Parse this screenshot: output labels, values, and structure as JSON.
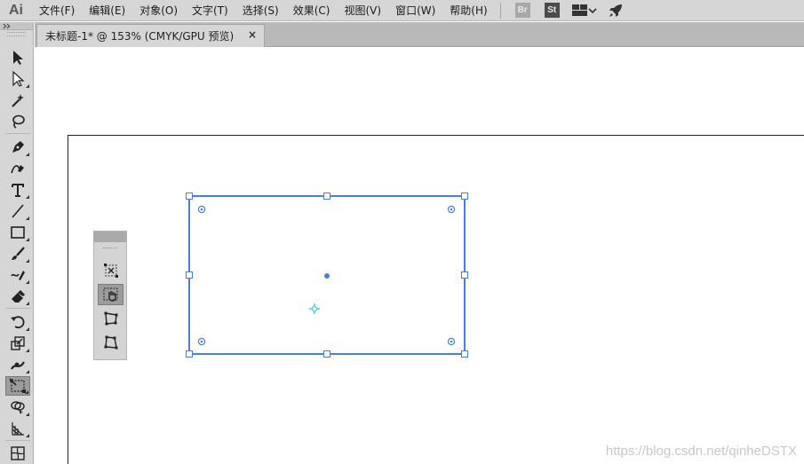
{
  "app": {
    "logo": "Ai",
    "menus": [
      "文件(F)",
      "编辑(E)",
      "对象(O)",
      "文字(T)",
      "选择(S)",
      "效果(C)",
      "视图(V)",
      "窗口(W)",
      "帮助(H)"
    ],
    "badges": {
      "bridge": "Br",
      "stock": "St"
    },
    "workspace_icon": "workspace-grid-icon",
    "launch_icon": "rocket-icon"
  },
  "document": {
    "tab_title": "未标题-1* @ 153% (CMYK/GPU 预览)",
    "close_glyph": "×"
  },
  "toolbar": {
    "tools": [
      "selection-tool",
      "direct-selection-tool",
      "magic-wand-tool",
      "lasso-tool",
      "pen-tool",
      "curvature-tool",
      "type-tool",
      "line-tool",
      "rectangle-tool",
      "paintbrush-tool",
      "shaper-tool",
      "eraser-tool",
      "rotate-tool",
      "scale-tool",
      "width-tool",
      "free-transform-tool",
      "shape-builder-tool",
      "perspective-grid-tool",
      "mesh-tool"
    ],
    "active_tool": "free-transform-tool"
  },
  "free_transform_panel": {
    "tools": [
      "constrain-icon",
      "free-transform-icon",
      "perspective-distort-icon",
      "free-distort-icon"
    ],
    "active": "free-transform-icon"
  },
  "colors": {
    "selection": "#4a7ee0",
    "center_point": "#3fd6e6"
  },
  "watermark": "https://blog.csdn.net/qinheDSTX"
}
